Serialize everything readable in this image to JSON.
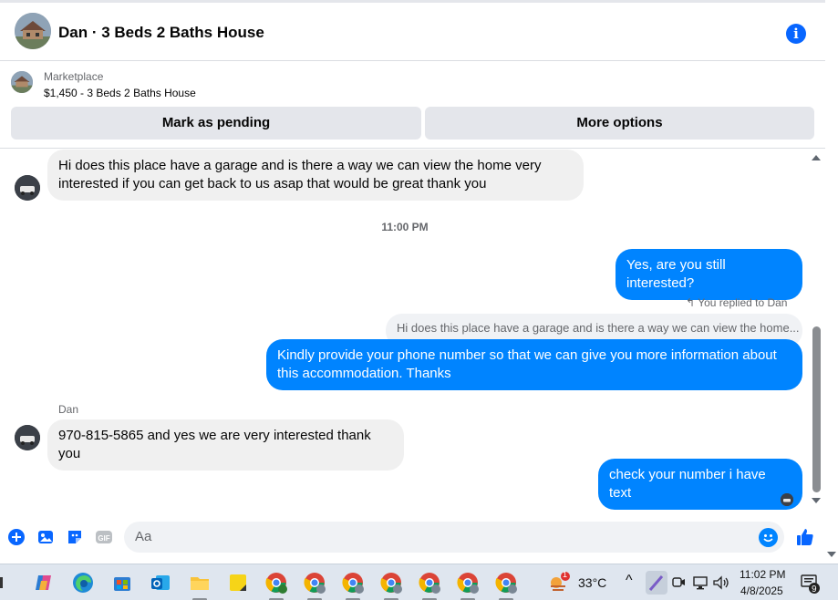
{
  "header": {
    "title": "Dan · 3 Beds 2 Baths House",
    "info_icon": "info-icon"
  },
  "listing": {
    "source": "Marketplace",
    "price_title": "$1,450 - 3 Beds 2 Baths House",
    "mark_pending_label": "Mark as pending",
    "more_options_label": "More options"
  },
  "messages": {
    "m1": "Hi does this place have a garage and is there a way we can view the home very interested if you can get back to us asap that would be great thank you",
    "timestamp": "11:00 PM",
    "m2": "Yes, are you still interested?",
    "reply_label": "You replied to Dan",
    "reply_quote": "Hi does this place have a garage and is there a way we can view the home...",
    "m3": "Kindly provide your phone number so that we can give you more information about this accommodation. Thanks",
    "sender": "Dan",
    "m4": "970-815-5865 and yes we are very interested thank you",
    "m5": "check your number i have text"
  },
  "composer": {
    "placeholder": "Aa"
  },
  "taskbar": {
    "weather_temp": "33°C",
    "weather_badge": "1",
    "time": "11:02 PM",
    "date": "4/8/2025",
    "notification_count": "9"
  },
  "colors": {
    "accent": "#0866ff",
    "outgoing_bubble": "#0084ff",
    "incoming_bubble": "#f0f0f0"
  }
}
